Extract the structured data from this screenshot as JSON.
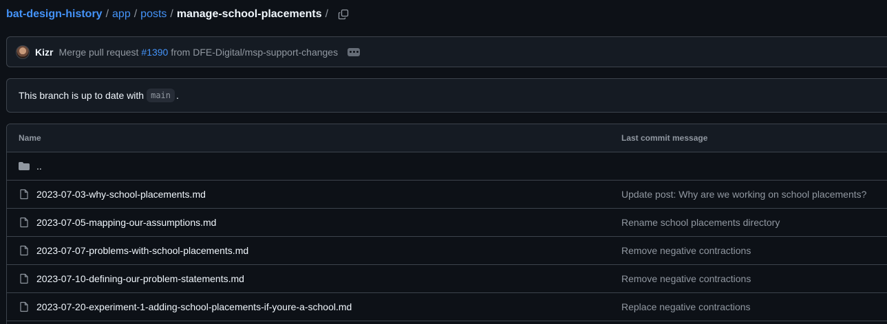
{
  "breadcrumb": {
    "repo": "bat-design-history",
    "segments": [
      "app",
      "posts"
    ],
    "current": "manage-school-placements",
    "separator": "/"
  },
  "commit": {
    "author": "Kizr",
    "message_prefix": "Merge pull request",
    "pr_number": "#1390",
    "message_suffix": "from DFE-Digital/msp-support-changes"
  },
  "branch_status": {
    "text_before": "This branch is up to date with",
    "branch": "main",
    "text_after": "."
  },
  "table": {
    "headers": {
      "name": "Name",
      "last_commit": "Last commit message"
    },
    "parent_dir": "..",
    "files": [
      {
        "name": "2023-07-03-why-school-placements.md",
        "message": "Update post: Why are we working on school placements?"
      },
      {
        "name": "2023-07-05-mapping-our-assumptions.md",
        "message": "Rename school placements directory"
      },
      {
        "name": "2023-07-07-problems-with-school-placements.md",
        "message": "Remove negative contractions"
      },
      {
        "name": "2023-07-10-defining-our-problem-statements.md",
        "message": "Remove negative contractions"
      },
      {
        "name": "2023-07-20-experiment-1-adding-school-placements-if-youre-a-school.md",
        "message": "Replace negative contractions"
      }
    ]
  },
  "icons": {
    "copy": "copy-icon",
    "folder": "folder-icon",
    "file": "file-icon",
    "ellipsis": "ellipsis-icon"
  },
  "colors": {
    "background": "#0d1117",
    "link": "#4493f8",
    "muted": "#9198a1",
    "border": "#3d444d"
  }
}
